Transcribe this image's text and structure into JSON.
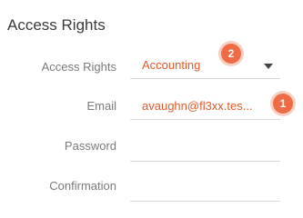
{
  "section": {
    "title": "Access Rights"
  },
  "form": {
    "access_rights": {
      "label": "Access Rights",
      "value": "Accounting"
    },
    "email": {
      "label": "Email",
      "value": "avaughn@fl3xx.tes..."
    },
    "password": {
      "label": "Password",
      "value": ""
    },
    "confirmation": {
      "label": "Confirmation",
      "value": ""
    }
  },
  "badges": {
    "first": "1",
    "second": "2"
  },
  "colors": {
    "accent": "#e4592a",
    "badge": "#ef6b45"
  }
}
